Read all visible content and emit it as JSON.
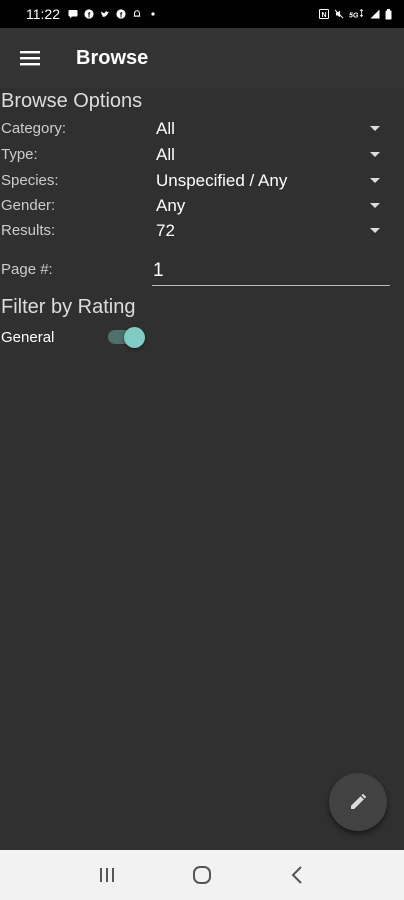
{
  "status_bar": {
    "time": "11:22",
    "left_icons": [
      "message-icon",
      "facebook-icon",
      "twitter-icon",
      "facebook-icon",
      "bell-icon",
      "dot-icon"
    ],
    "right_icons": [
      "nfc-icon",
      "mute-icon",
      "5g-icon",
      "signal-icon",
      "battery-icon"
    ],
    "network": "5G"
  },
  "app_bar": {
    "title": "Browse",
    "menu_icon": "hamburger-menu-icon"
  },
  "browse_options": {
    "title": "Browse Options",
    "rows": [
      {
        "label": "Category:",
        "value": "All"
      },
      {
        "label": "Type:",
        "value": "All"
      },
      {
        "label": "Species:",
        "value": "Unspecified / Any"
      },
      {
        "label": "Gender:",
        "value": "Any"
      },
      {
        "label": "Results:",
        "value": "72"
      }
    ],
    "page": {
      "label": "Page #:",
      "value": "1"
    }
  },
  "filter_by_rating": {
    "title": "Filter by Rating",
    "switches": [
      {
        "label": "General",
        "on": true
      }
    ]
  },
  "fab": {
    "icon": "pencil-icon"
  },
  "nav_bar": {
    "icons": [
      "recent-apps-icon",
      "home-icon",
      "back-icon"
    ]
  },
  "colors": {
    "app_bar": "#333333",
    "background": "#303030",
    "accent": "#80cbc4",
    "nav_bar": "#f2f2f2"
  }
}
